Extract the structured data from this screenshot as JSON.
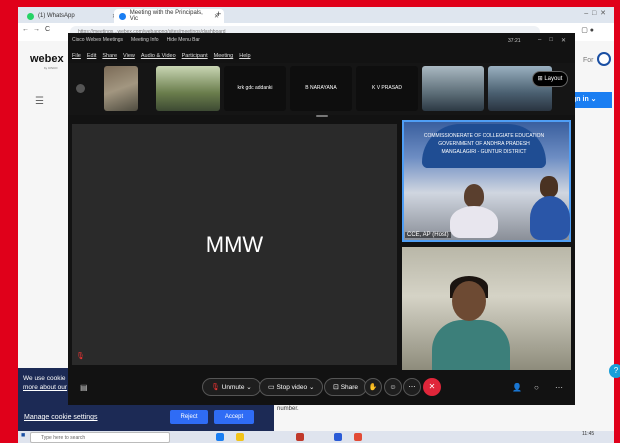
{
  "browser": {
    "tabs": [
      {
        "label": "(1) WhatsApp",
        "color": "#25d366"
      },
      {
        "label": "Meeting with the Principals, Vic",
        "color": "#1a7ef2"
      }
    ],
    "new_tab": "+",
    "address": "https://meetings...webex.com/webappng/sites/meetings/dashboard"
  },
  "webex_page": {
    "logo": "webex",
    "logo_sub": "by CISCO",
    "for_text": "For",
    "sign_in": "gn in",
    "number_text": "number."
  },
  "cookie": {
    "line1": "We use cookie",
    "line2": "more about our",
    "manage": "Manage cookie settings",
    "reject": "Reject",
    "accept": "Accept"
  },
  "taskbar": {
    "search_placeholder": "Type here to search",
    "time": "11:45"
  },
  "meeting": {
    "title_items": [
      "Cisco Webex Meetings",
      "Meeting Info",
      "Hide Menu Bar"
    ],
    "time": "37:21",
    "menu": [
      "File",
      "Edit",
      "Share",
      "View",
      "Audio & Video",
      "Participant",
      "Meeting",
      "Help"
    ],
    "thumbnails": [
      "",
      "",
      "krk gdc addanki",
      "B NARAYANA",
      "K V PRASAD",
      "",
      ""
    ],
    "layout_label": "Layout",
    "main_name": "MMW",
    "host_label": "CCE, AP (Host)",
    "banner_text": [
      "COMMISSIONERATE OF COLLEGIATE EDUCATION",
      "GOVERNMENT OF ANDHRA PRADESH",
      "MANGALAGIRI - GUNTUR DISTRICT"
    ],
    "controls": {
      "unmute": "Unmute",
      "stop_video": "Stop video",
      "share": "Share"
    },
    "colors": {
      "leave": "#e0263a",
      "accent": "#4f9ef5"
    }
  }
}
